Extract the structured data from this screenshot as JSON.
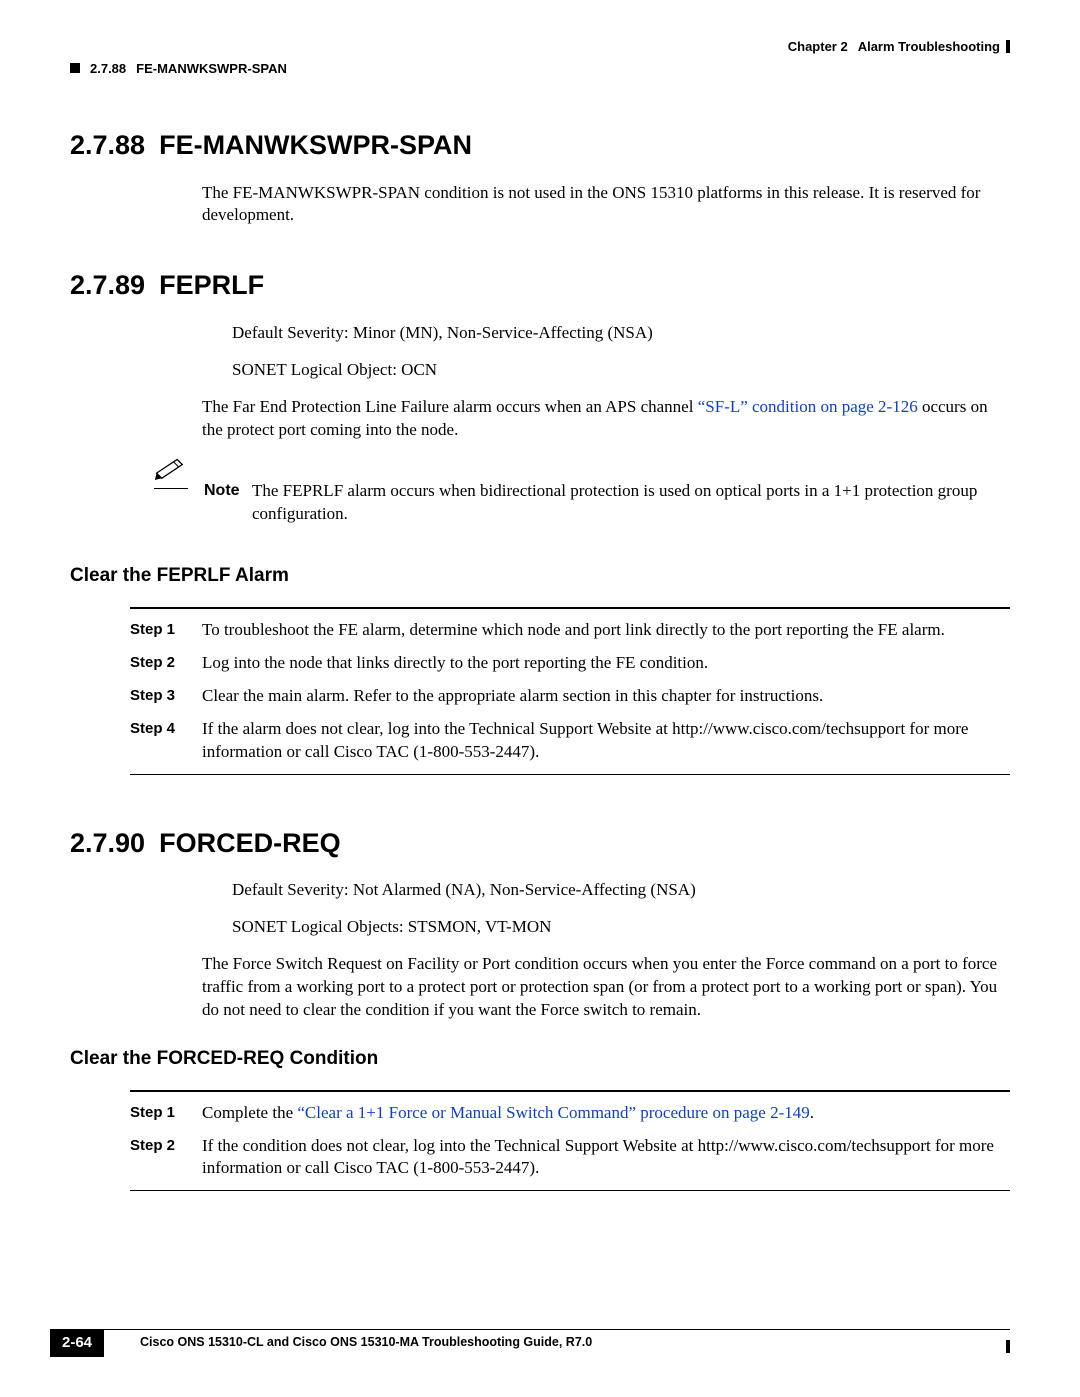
{
  "header": {
    "chapter_label": "Chapter 2",
    "chapter_title": "Alarm Troubleshooting",
    "section_ref": "2.7.88",
    "section_ref_title": "FE-MANWKSWPR-SPAN"
  },
  "sections": {
    "s88": {
      "num": "2.7.88",
      "title": "FE-MANWKSWPR-SPAN",
      "para": "The FE-MANWKSWPR-SPAN condition is not used in the ONS 15310 platforms in this release. It is reserved for development."
    },
    "s89": {
      "num": "2.7.89",
      "title": "FEPRLF",
      "severity_line": "Default Severity: Minor (MN), Non-Service-Affecting (NSA)",
      "logical_line": "SONET Logical Object: OCN",
      "para_pre": "The Far End Protection Line Failure alarm occurs when an APS channel ",
      "link_text": "“SF-L” condition on page 2-126",
      "para_post": " occurs on the protect port coming into the node.",
      "note_label": "Note",
      "note_body": "The FEPRLF alarm occurs when bidirectional protection is used on optical ports in a 1+1 protection group configuration.",
      "clear_head": "Clear the FEPRLF Alarm",
      "steps": [
        {
          "label": "Step 1",
          "text": "To troubleshoot the FE alarm, determine which node and port link directly to the port reporting the FE alarm."
        },
        {
          "label": "Step 2",
          "text": "Log into the node that links directly to the port reporting the FE condition."
        },
        {
          "label": "Step 3",
          "text": "Clear the main alarm. Refer to the appropriate alarm section in this chapter for instructions."
        },
        {
          "label": "Step 4",
          "text": "If the alarm does not clear, log into the Technical Support Website at http://www.cisco.com/techsupport for more information or call Cisco TAC (1-800-553-2447)."
        }
      ]
    },
    "s90": {
      "num": "2.7.90",
      "title": "FORCED-REQ",
      "severity_line": "Default Severity: Not Alarmed (NA), Non-Service-Affecting (NSA)",
      "logical_line": "SONET Logical Objects: STSMON, VT-MON",
      "para": "The Force Switch Request on Facility or Port condition occurs when you enter the Force command on a port to force traffic from a working port to a protect port or protection span (or from a protect port to a working port or span). You do not need to clear the condition if you want the Force switch to remain.",
      "clear_head": "Clear the FORCED-REQ Condition",
      "steps": [
        {
          "label": "Step 1",
          "pre": "Complete the ",
          "link": "“Clear a 1+1 Force or Manual Switch Command” procedure on page 2-149",
          "post": "."
        },
        {
          "label": "Step 2",
          "text": "If the condition does not clear, log into the Technical Support Website at http://www.cisco.com/techsupport for more information or call Cisco TAC (1-800-553-2447)."
        }
      ]
    }
  },
  "footer": {
    "doc_title": "Cisco ONS 15310-CL and Cisco ONS 15310-MA Troubleshooting Guide, R7.0",
    "page_num": "2-64"
  }
}
